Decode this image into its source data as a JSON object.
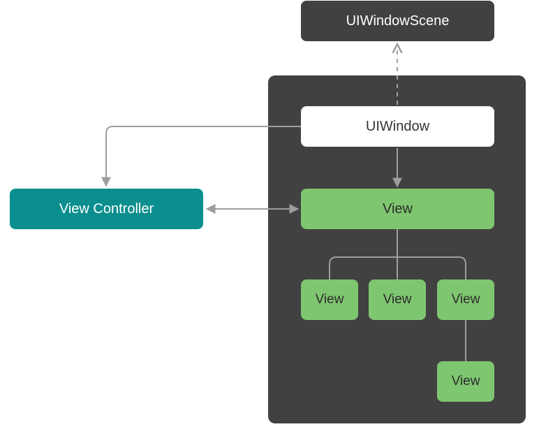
{
  "nodes": {
    "windowScene": "UIWindowScene",
    "window": "UIWindow",
    "viewController": "View Controller",
    "rootView": "View",
    "child1": "View",
    "child2": "View",
    "child3": "View",
    "grandchild": "View"
  },
  "colors": {
    "dark": "#414141",
    "green": "#7fc671",
    "teal": "#0b8e8e",
    "stroke": "#9e9e9e"
  }
}
